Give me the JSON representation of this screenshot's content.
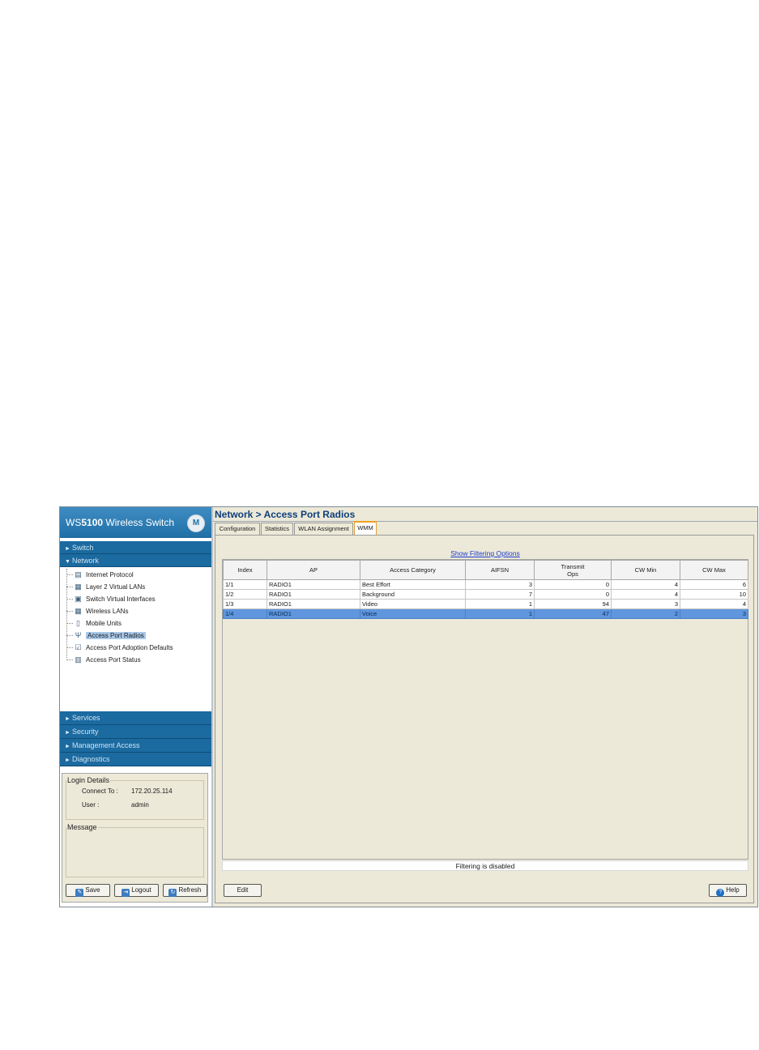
{
  "brand": {
    "prefix": "WS",
    "model": "5100",
    "suffix": " Wireless Switch",
    "logo": "M"
  },
  "nav": {
    "top": [
      "Switch",
      "Network"
    ],
    "tree": [
      {
        "label": "Internet Protocol",
        "icon": "protocol-icon"
      },
      {
        "label": "Layer 2 Virtual LANs",
        "icon": "vlan-icon"
      },
      {
        "label": "Switch Virtual Interfaces",
        "icon": "interface-icon"
      },
      {
        "label": "Wireless LANs",
        "icon": "wlan-icon"
      },
      {
        "label": "Mobile Units",
        "icon": "mobile-unit-icon"
      },
      {
        "label": "Access Port Radios",
        "icon": "radio-antenna-icon",
        "selected": true
      },
      {
        "label": "Access Port Adoption Defaults",
        "icon": "adoption-icon"
      },
      {
        "label": "Access Port Status",
        "icon": "status-icon"
      }
    ],
    "bottom": [
      "Services",
      "Security",
      "Management Access",
      "Diagnostics"
    ]
  },
  "login": {
    "legend": "Login Details",
    "connect_label": "Connect To :",
    "connect_value": "172.20.25.114",
    "user_label": "User :",
    "user_value": "admin"
  },
  "message": {
    "legend": "Message"
  },
  "buttons": {
    "save": "Save",
    "logout": "Logout",
    "refresh": "Refresh",
    "edit": "Edit",
    "help": "Help"
  },
  "page": {
    "title": "Network > Access Port Radios"
  },
  "tabs": [
    "Configuration",
    "Statistics",
    "WLAN Assignment",
    "WMM"
  ],
  "filter_link": "Show Filtering Options",
  "table": {
    "headers": [
      "Index",
      "AP",
      "Access Category",
      "AIFSN",
      "Transmit Ops",
      "CW Min",
      "CW Max"
    ],
    "rows": [
      [
        "1/1",
        "RADIO1",
        "Best Effort",
        "3",
        "0",
        "4",
        "6"
      ],
      [
        "1/2",
        "RADIO1",
        "Background",
        "7",
        "0",
        "4",
        "10"
      ],
      [
        "1/3",
        "RADIO1",
        "Video",
        "1",
        "94",
        "3",
        "4"
      ],
      [
        "1/4",
        "RADIO1",
        "Voice",
        "1",
        "47",
        "2",
        "3"
      ]
    ]
  },
  "status": "Filtering is disabled"
}
